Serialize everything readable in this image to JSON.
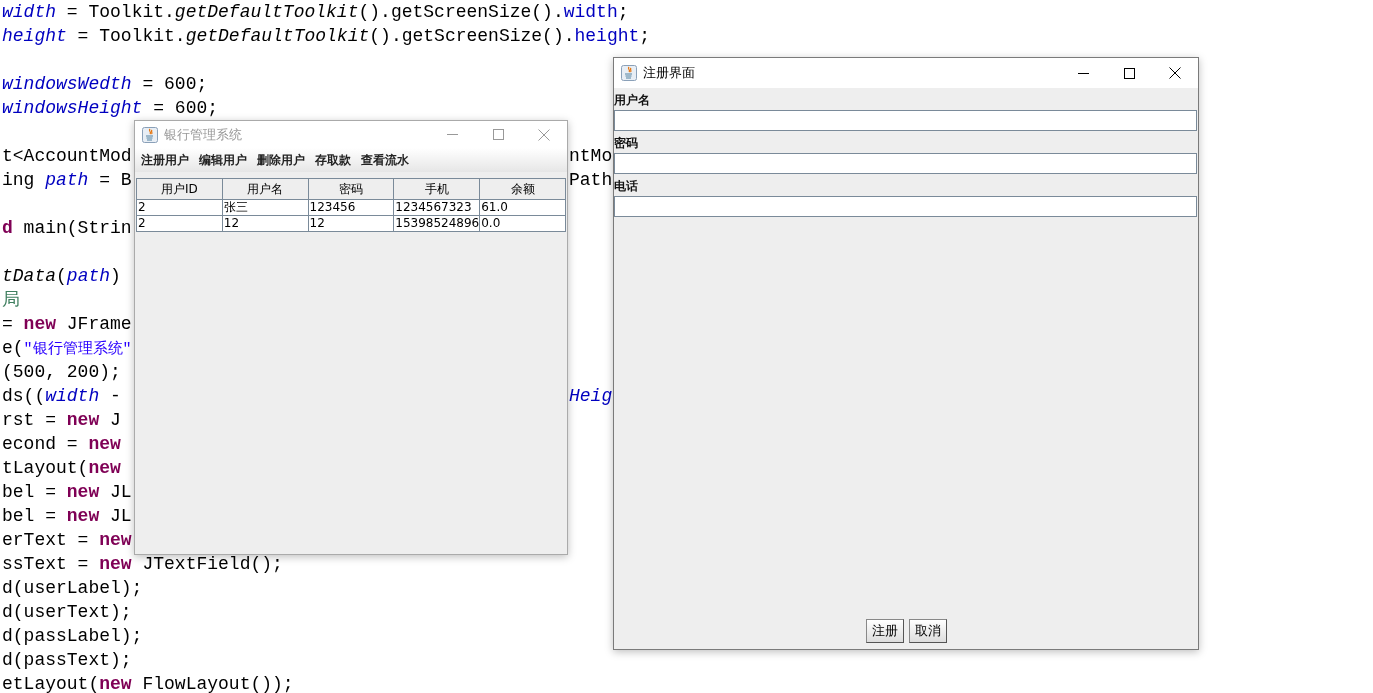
{
  "code_lines": [
    {
      "kind": "code",
      "segments": [
        {
          "kind": "field",
          "text": "width"
        },
        {
          "kind": "plain",
          "text": " = Toolkit."
        },
        {
          "kind": "static",
          "text": "getDefaultToolkit"
        },
        {
          "kind": "plain",
          "text": "().getScreenSize()."
        },
        {
          "kind": "member",
          "text": "width"
        },
        {
          "kind": "plain",
          "text": ";"
        }
      ]
    },
    {
      "kind": "code",
      "segments": [
        {
          "kind": "field",
          "text": "height"
        },
        {
          "kind": "plain",
          "text": " = Toolkit."
        },
        {
          "kind": "static",
          "text": "getDefaultToolkit"
        },
        {
          "kind": "plain",
          "text": "().getScreenSize()."
        },
        {
          "kind": "member",
          "text": "height"
        },
        {
          "kind": "plain",
          "text": ";"
        }
      ]
    },
    {
      "kind": "blank"
    },
    {
      "kind": "code",
      "segments": [
        {
          "kind": "field",
          "text": "windowsWedth"
        },
        {
          "kind": "plain",
          "text": " = 600;"
        }
      ]
    },
    {
      "kind": "code",
      "segments": [
        {
          "kind": "field",
          "text": "windowsHeight"
        },
        {
          "kind": "plain",
          "text": " = 600;"
        }
      ]
    },
    {
      "kind": "blank"
    },
    {
      "kind": "code",
      "segments": [
        {
          "kind": "plain",
          "text": "t<AccountMod"
        }
      ],
      "right": [
        {
          "kind": "plain",
          "text": "ntMo"
        }
      ]
    },
    {
      "kind": "code",
      "segments": [
        {
          "kind": "plain",
          "text": "ing "
        },
        {
          "kind": "field",
          "text": "path"
        },
        {
          "kind": "plain",
          "text": " = B"
        }
      ],
      "right": [
        {
          "kind": "plain",
          "text": "Path"
        }
      ]
    },
    {
      "kind": "blank"
    },
    {
      "kind": "code",
      "segments": [
        {
          "kind": "keyword",
          "text": "d"
        },
        {
          "kind": "plain",
          "text": " main(Strin"
        }
      ]
    },
    {
      "kind": "blank"
    },
    {
      "kind": "code",
      "segments": [
        {
          "kind": "static",
          "text": "tData"
        },
        {
          "kind": "plain",
          "text": "("
        },
        {
          "kind": "field",
          "text": "path"
        },
        {
          "kind": "plain",
          "text": ")"
        }
      ]
    },
    {
      "kind": "code",
      "segments": [
        {
          "kind": "comment",
          "text": "局"
        }
      ]
    },
    {
      "kind": "code",
      "segments": [
        {
          "kind": "plain",
          "text": "= "
        },
        {
          "kind": "keyword",
          "text": "new"
        },
        {
          "kind": "plain",
          "text": " JFrame"
        }
      ]
    },
    {
      "kind": "code",
      "segments": [
        {
          "kind": "plain",
          "text": "e("
        },
        {
          "kind": "string",
          "text": "\"银行管理系统\""
        }
      ]
    },
    {
      "kind": "code",
      "segments": [
        {
          "kind": "plain",
          "text": "(500, 200);"
        }
      ]
    },
    {
      "kind": "code",
      "segments": [
        {
          "kind": "plain",
          "text": "ds(("
        },
        {
          "kind": "field",
          "text": "width"
        },
        {
          "kind": "plain",
          "text": " -"
        }
      ],
      "right": [
        {
          "kind": "field",
          "text": "Heig"
        }
      ]
    },
    {
      "kind": "code",
      "segments": [
        {
          "kind": "plain",
          "text": "rst = "
        },
        {
          "kind": "keyword",
          "text": "new"
        },
        {
          "kind": "plain",
          "text": " J"
        }
      ]
    },
    {
      "kind": "code",
      "segments": [
        {
          "kind": "plain",
          "text": "econd = "
        },
        {
          "kind": "keyword",
          "text": "new"
        }
      ]
    },
    {
      "kind": "code",
      "segments": [
        {
          "kind": "plain",
          "text": "tLayout("
        },
        {
          "kind": "keyword",
          "text": "new"
        }
      ]
    },
    {
      "kind": "code",
      "segments": [
        {
          "kind": "plain",
          "text": "bel = "
        },
        {
          "kind": "keyword",
          "text": "new"
        },
        {
          "kind": "plain",
          "text": " JL"
        }
      ]
    },
    {
      "kind": "code",
      "segments": [
        {
          "kind": "plain",
          "text": "bel = "
        },
        {
          "kind": "keyword",
          "text": "new"
        },
        {
          "kind": "plain",
          "text": " JL"
        }
      ]
    },
    {
      "kind": "code",
      "segments": [
        {
          "kind": "plain",
          "text": "erText = "
        },
        {
          "kind": "keyword",
          "text": "new"
        }
      ]
    },
    {
      "kind": "code",
      "segments": [
        {
          "kind": "plain",
          "text": "ssText = "
        },
        {
          "kind": "keyword",
          "text": "new"
        },
        {
          "kind": "plain",
          "text": " JTextField();"
        }
      ]
    },
    {
      "kind": "code",
      "segments": [
        {
          "kind": "plain",
          "text": "d(userLabel);"
        }
      ]
    },
    {
      "kind": "code",
      "segments": [
        {
          "kind": "plain",
          "text": "d(userText);"
        }
      ]
    },
    {
      "kind": "code",
      "segments": [
        {
          "kind": "plain",
          "text": "d(passLabel);"
        }
      ]
    },
    {
      "kind": "code",
      "segments": [
        {
          "kind": "plain",
          "text": "d(passText);"
        }
      ]
    },
    {
      "kind": "code",
      "segments": [
        {
          "kind": "plain",
          "text": "etLayout("
        },
        {
          "kind": "keyword",
          "text": "new"
        },
        {
          "kind": "plain",
          "text": " FlowLayout());"
        }
      ]
    }
  ],
  "bank_window": {
    "title": "银行管理系统",
    "active": false,
    "menu": [
      "注册用户",
      "编辑用户",
      "删除用户",
      "存取款",
      "查看流水"
    ],
    "table": {
      "columns": [
        "用户ID",
        "用户名",
        "密码",
        "手机",
        "余额"
      ],
      "rows": [
        {
          "cells": [
            "2",
            "张三",
            "123456",
            "1234567323",
            "61.0"
          ]
        },
        {
          "cells": [
            "2",
            "12",
            "12",
            "15398524896",
            "0.0"
          ]
        }
      ]
    }
  },
  "register_window": {
    "title": "注册界面",
    "active": true,
    "fields": [
      {
        "label": "用户名"
      },
      {
        "label": "密码"
      },
      {
        "label": "电话"
      }
    ],
    "buttons": [
      "注册",
      "取消"
    ]
  }
}
